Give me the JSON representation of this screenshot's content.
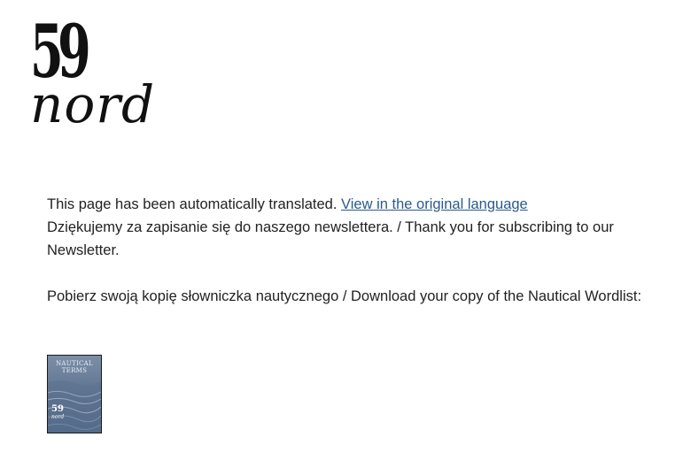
{
  "logo": {
    "number": "59",
    "word": "nord"
  },
  "notice": {
    "text": "This page has been automatically translated.",
    "link_label": "View in the original language"
  },
  "messages": {
    "thanks": "Dziękujemy za zapisanie się do naszego newslettera. / Thank you for subscribing to our Newsletter.",
    "download": "Pobierz swoją kopię słowniczka nautycznego / Download your copy of the Nautical Wordlist:"
  },
  "cover": {
    "title_line1": "NAUTICAL",
    "title_line2": "TERMS",
    "logo_number": "59",
    "logo_word": "nord"
  },
  "colors": {
    "link": "#2a5a8c",
    "text": "#222222",
    "cover_background": "#5a6f8c"
  }
}
